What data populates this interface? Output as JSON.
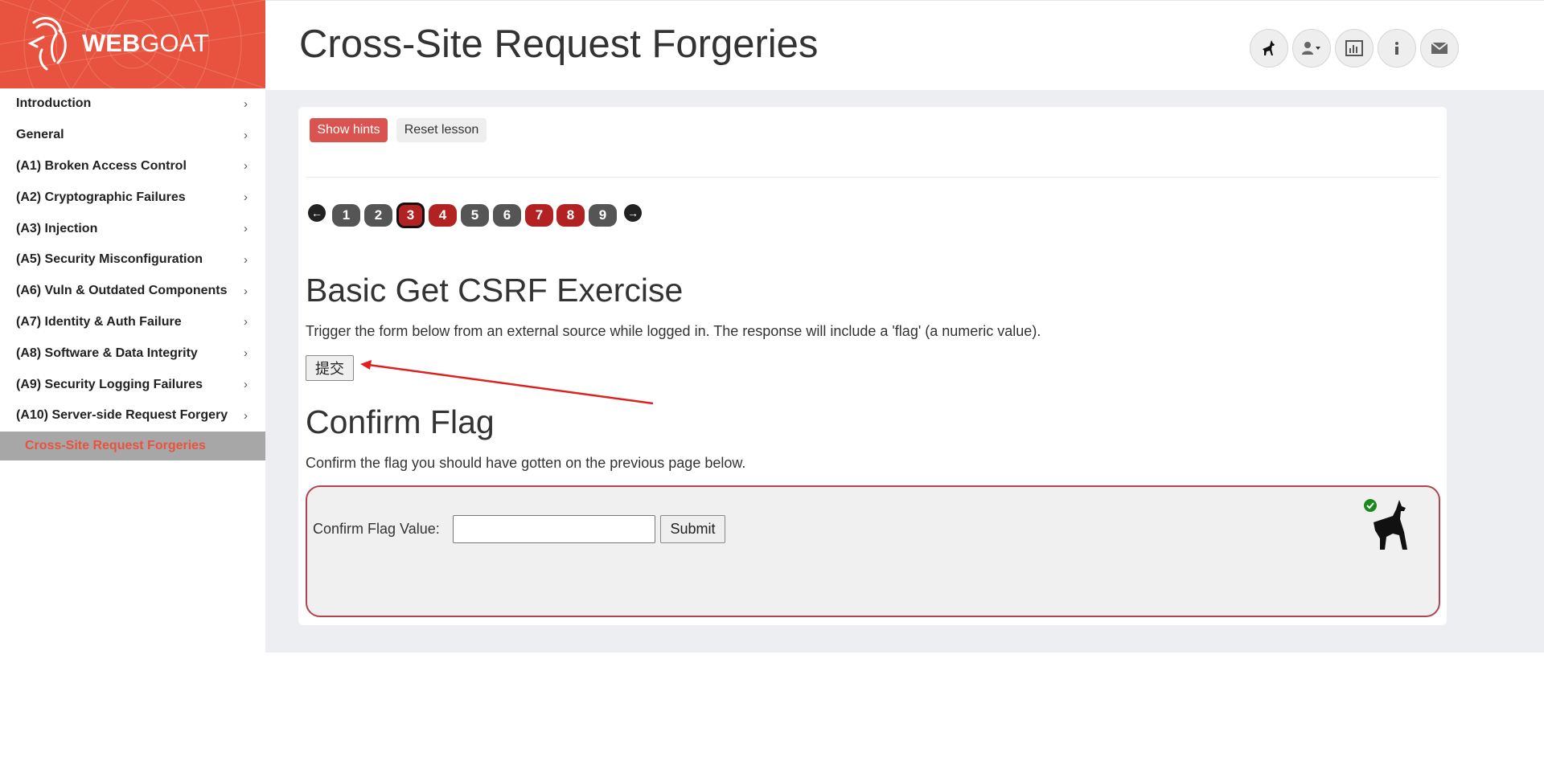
{
  "brand": {
    "bold": "WEB",
    "light": "GOAT"
  },
  "sidebar": {
    "items": [
      {
        "label": "Introduction"
      },
      {
        "label": "General"
      },
      {
        "label": "(A1) Broken Access Control"
      },
      {
        "label": "(A2) Cryptographic Failures"
      },
      {
        "label": "(A3) Injection"
      },
      {
        "label": "(A5) Security Misconfiguration"
      },
      {
        "label": "(A6) Vuln & Outdated Components"
      },
      {
        "label": "(A7) Identity & Auth Failure"
      },
      {
        "label": "(A8) Software & Data Integrity"
      },
      {
        "label": "(A9) Security Logging Failures"
      },
      {
        "label": "(A10) Server-side Request Forgery"
      }
    ],
    "chevron": "›",
    "active_sub": "Cross-Site Request Forgeries"
  },
  "header": {
    "title": "Cross-Site Request Forgeries",
    "icons": [
      "wolf-icon",
      "user-icon",
      "chart-icon",
      "info-icon",
      "envelope-icon"
    ]
  },
  "lesson": {
    "show_hints": "Show hints",
    "reset_lesson": "Reset lesson",
    "pages": [
      {
        "label": "1",
        "state": "gray"
      },
      {
        "label": "2",
        "state": "gray"
      },
      {
        "label": "3",
        "state": "current"
      },
      {
        "label": "4",
        "state": "red"
      },
      {
        "label": "5",
        "state": "gray"
      },
      {
        "label": "6",
        "state": "gray"
      },
      {
        "label": "7",
        "state": "red"
      },
      {
        "label": "8",
        "state": "red"
      },
      {
        "label": "9",
        "state": "gray"
      }
    ],
    "prev_arrow": "←",
    "next_arrow": "→",
    "exercise_title": "Basic Get CSRF Exercise",
    "exercise_text": "Trigger the form below from an external source while logged in. The response will include a 'flag' (a numeric value).",
    "exercise_button": "提交",
    "confirm_title": "Confirm Flag",
    "confirm_text": "Confirm the flag you should have gotten on the previous page below.",
    "flag_label": "Confirm Flag Value:",
    "flag_value": "",
    "flag_submit": "Submit"
  },
  "colors": {
    "brand": "#e8533f",
    "hints": "#d9534f",
    "page_red": "#b22222",
    "page_gray": "#555555",
    "annotation_arrow": "#e02020",
    "success": "#1a8a1a"
  }
}
